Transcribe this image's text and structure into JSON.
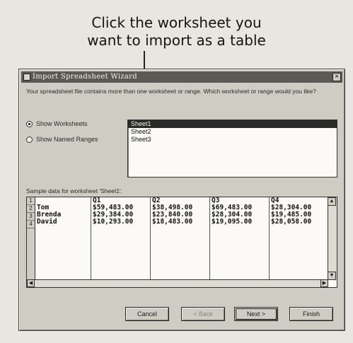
{
  "callout": {
    "line1": "Click the worksheet you",
    "line2": "want to import as a table"
  },
  "dialog": {
    "title": "Import Spreadsheet Wizard",
    "close_label": "×",
    "intro": "Your spreadsheet file contains more than one worksheet or range. Which worksheet or range would you like?",
    "options": [
      {
        "label": "Show Worksheets",
        "checked": true
      },
      {
        "label": "Show Named Ranges",
        "checked": false
      }
    ],
    "sheets": [
      "Sheet1",
      "Sheet2",
      "Sheet3"
    ],
    "selected_sheet": "Sheet1",
    "sample_label": "Sample data for worksheet 'Sheet1'.",
    "grid": {
      "row_numbers": [
        "1",
        "2",
        "3",
        "4"
      ],
      "columns": [
        [
          "",
          "Tom",
          "Brenda",
          "David"
        ],
        [
          "Q1",
          "$59,483.00",
          "$29,384.00",
          "$10,293.00"
        ],
        [
          "Q2",
          "$38,498.00",
          "$23,840.00",
          "$18,483.00"
        ],
        [
          "Q3",
          "$69,483.00",
          "$28,304.00",
          "$19,095.00"
        ],
        [
          "Q4",
          "$28,304.00",
          "$19,485.00",
          "$28,058.00"
        ]
      ]
    },
    "buttons": {
      "cancel": "Cancel",
      "back": "< Back",
      "next": "Next >",
      "finish": "Finish"
    }
  }
}
